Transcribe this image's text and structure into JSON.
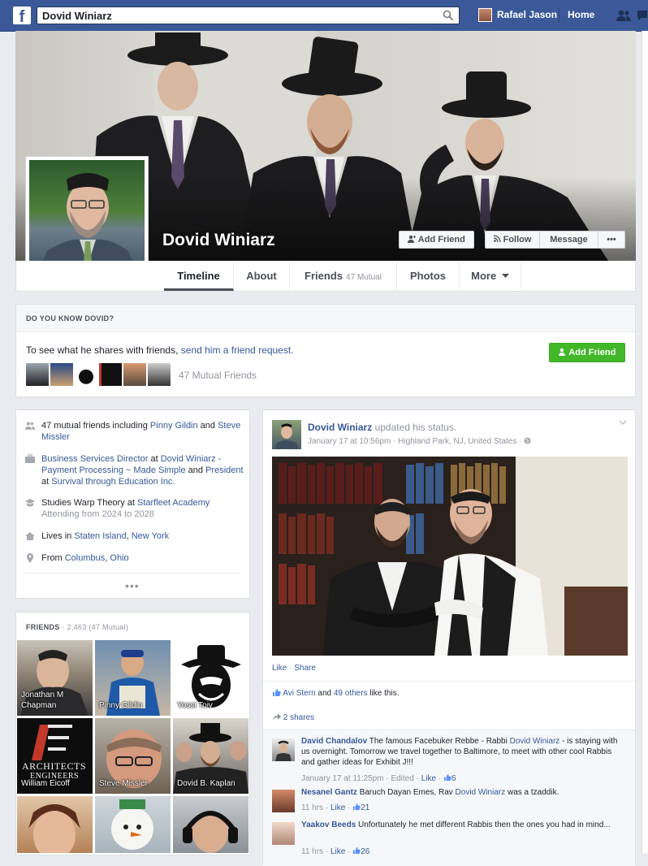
{
  "topbar": {
    "logo": "f",
    "search_value": "Dovid Winiarz",
    "user_name": "Rafael Jason",
    "home_label": "Home"
  },
  "profile": {
    "name": "Dovid Winiarz",
    "add_friend_label": "Add Friend",
    "follow_label": "Follow",
    "message_label": "Message",
    "more_label": "•••"
  },
  "tabs": {
    "timeline": "Timeline",
    "about": "About",
    "friends": "Friends",
    "friends_mutual": "47 Mutual",
    "photos": "Photos",
    "more": "More"
  },
  "know": {
    "title": "DO YOU KNOW DOVID?",
    "text_prefix": "To see what he shares with friends, ",
    "text_link": "send him a friend request.",
    "add_friend_label": "Add Friend",
    "mutual_count": "47 Mutual Friends"
  },
  "intro": {
    "mutual_prefix": "47 mutual friends including ",
    "mutual_friend1": "Pinny Gildin",
    "mutual_and": " and ",
    "mutual_friend2": "Steve Missler",
    "work1_title": "Business Services Director",
    "work1_at": " at ",
    "work1_company": "Dovid Winiarz - Payment Processing ~ Made Simple",
    "work1_and": " and ",
    "work2_title": "President",
    "work2_at": " at ",
    "work2_company": "Survival through Education Inc.",
    "study_prefix": "Studies Warp Theory at ",
    "study_school": "Starfleet Academy",
    "study_sub": "Attending from 2024 to 2028",
    "lives_prefix": "Lives in ",
    "lives_city": "Staten Island",
    "lives_sep": ", ",
    "lives_state": "New York",
    "from_prefix": "From ",
    "from_city": "Columbus",
    "from_sep": ", ",
    "from_state": "Ohio",
    "more": "•••"
  },
  "friends": {
    "title": "FRIENDS",
    "count": " · 2,463 (47 Mutual)",
    "items": [
      {
        "name": "Jonathan M Chapman"
      },
      {
        "name": "Pinny Gildin"
      },
      {
        "name": "Yossi Toiv"
      },
      {
        "name": "William Eicoff"
      },
      {
        "name": "Steve Missler"
      },
      {
        "name": "Dovid B. Kaplan"
      }
    ],
    "logo_text1": "ARCHITECTS",
    "logo_text2": "ENGINEERS"
  },
  "post": {
    "author": "Dovid Winiarz",
    "action": " updated his status.",
    "meta": "January 17 at 10:56pm · Highland Park, NJ, United States · ",
    "like_label": "Like",
    "share_label": "Share",
    "sep": " · ",
    "likes_name": "Avi Stern",
    "likes_and": " and ",
    "likes_others": "49 others",
    "likes_suffix": " like this.",
    "shares": "2 shares",
    "comments": [
      {
        "author": "David Chandalov",
        "text_before": " The famous Facebuker Rebbe - Rabbi ",
        "mention": "Dovid Winiarz",
        "text_after": " - is staying with us overnight. Tomorrow we travel together to Baltimore, to meet with other cool Rabbis and gather ideas for Exhibit J!!!",
        "time": "January 17 at 11:25pm",
        "edited": " · Edited · ",
        "like": "Like",
        "likes": "6"
      },
      {
        "author": "Nesanel Gantz",
        "text_before": " Baruch Dayan Emes, Rav ",
        "mention": "Dovid Winiarz",
        "text_after": " was a tzaddik.",
        "time": "11 hrs",
        "edited": " · ",
        "like": "Like",
        "likes": "21"
      },
      {
        "author": "Yaakov Beeds",
        "text_before": " Unfortunately he met different Rabbis then the ones you had in mind...",
        "mention": "",
        "text_after": "",
        "time": "11 hrs",
        "edited": " · ",
        "like": "Like",
        "likes": "26"
      }
    ]
  },
  "colors": {
    "brand": "#3b5998",
    "link": "#365899",
    "add_friend_green": "#42b72a",
    "page_bg": "#e9ebee"
  },
  "icons": [
    "facebook-logo-icon",
    "search-icon",
    "friend-requests-icon",
    "messages-icon",
    "add-friend-icon",
    "follow-rss-icon",
    "mutual-friends-icon",
    "work-icon",
    "education-icon",
    "home-icon",
    "location-pin-icon",
    "globe-icon",
    "chevron-down-icon",
    "thumbs-up-icon",
    "share-icon"
  ]
}
